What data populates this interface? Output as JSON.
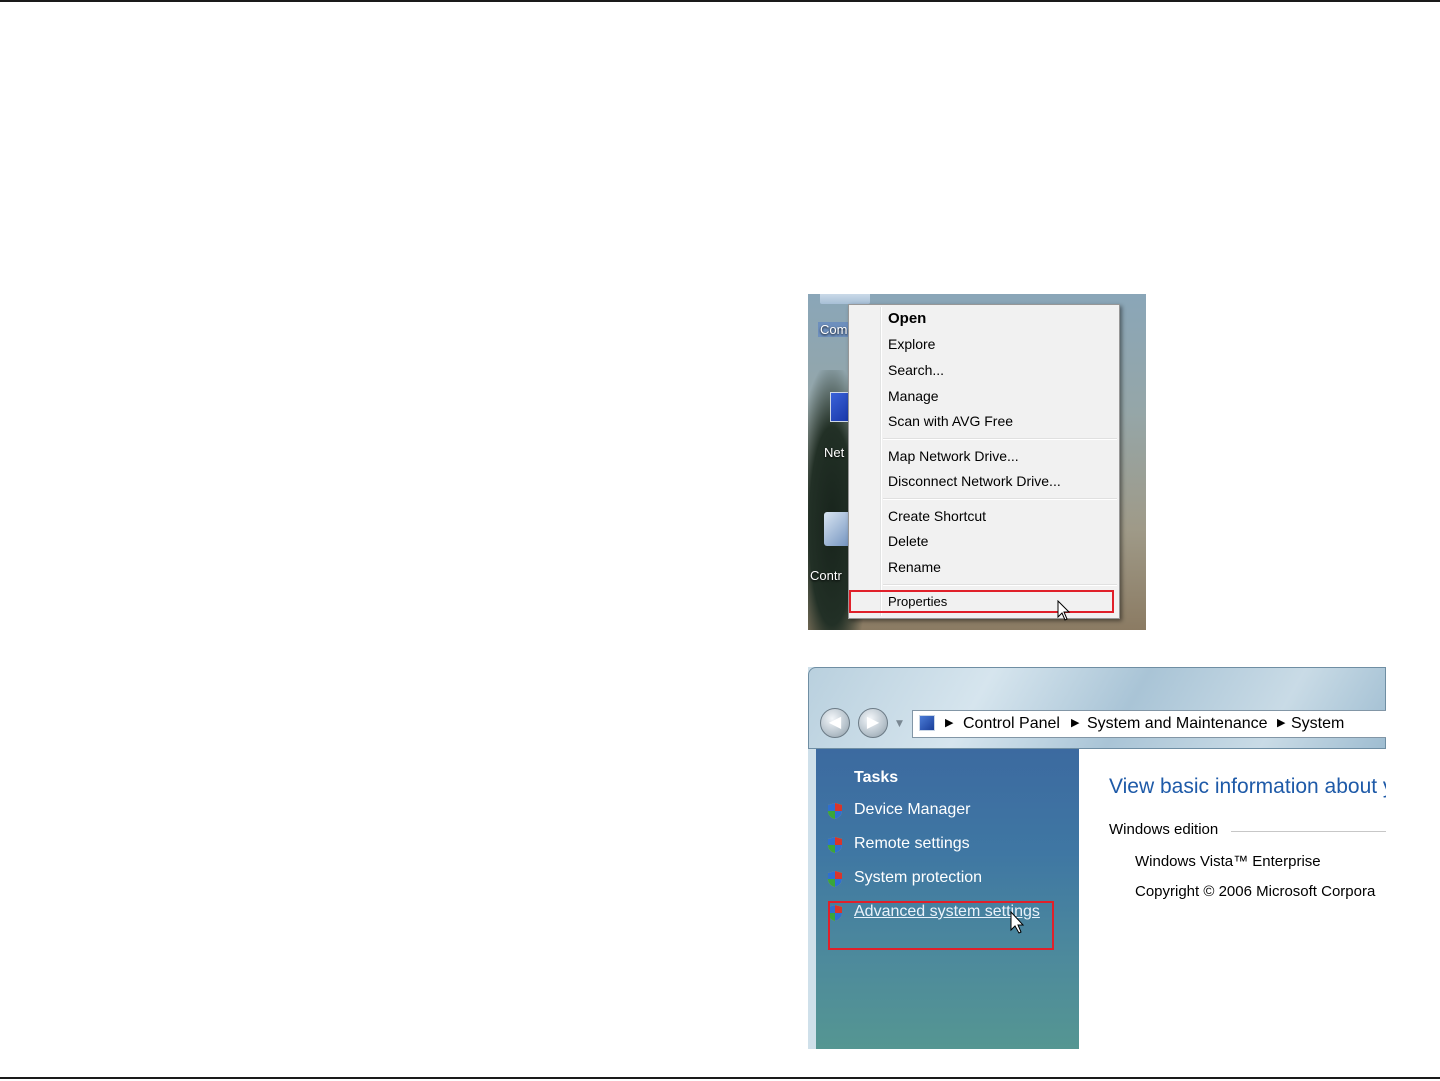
{
  "context_menu": {
    "desktop_labels": [
      "Com",
      "Net",
      "Contr"
    ],
    "items": [
      {
        "label": "Open",
        "bold": true
      },
      {
        "label": "Explore"
      },
      {
        "label": "Search..."
      },
      {
        "label": "Manage"
      },
      {
        "label": "Scan with AVG Free"
      },
      {
        "label": "Map Network Drive..."
      },
      {
        "label": "Disconnect Network Drive..."
      },
      {
        "label": "Create Shortcut"
      },
      {
        "label": "Delete"
      },
      {
        "label": "Rename"
      },
      {
        "label": "Properties"
      }
    ]
  },
  "system_window": {
    "breadcrumb": [
      "Control Panel",
      "System and Maintenance",
      "System"
    ],
    "tasks_title": "Tasks",
    "tasks": [
      {
        "label": "Device Manager"
      },
      {
        "label": "Remote settings"
      },
      {
        "label": "System protection"
      },
      {
        "label": "Advanced system settings"
      }
    ],
    "content": {
      "title": "View basic information about y",
      "section": "Windows edition",
      "edition": "Windows Vista™ Enterprise",
      "copyright": "Copyright © 2006 Microsoft Corpora"
    }
  },
  "colors": {
    "highlight_box": "#e0202a",
    "link_blue": "#1e5aa8",
    "tasks_pane": "#3f77a3"
  }
}
